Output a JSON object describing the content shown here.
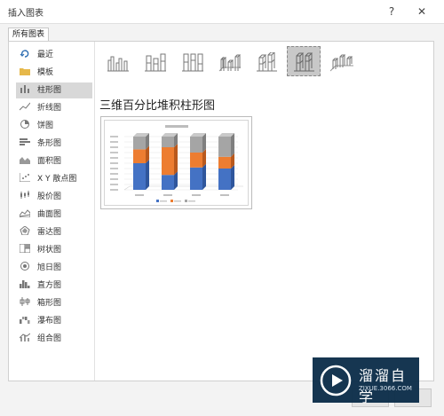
{
  "window": {
    "title": "插入图表",
    "help_label": "?",
    "close_label": "✕"
  },
  "tab": {
    "label": "所有图表"
  },
  "sidebar": {
    "items": [
      {
        "label": "最近",
        "icon": "recent-icon"
      },
      {
        "label": "模板",
        "icon": "folder-icon"
      },
      {
        "label": "柱形图",
        "icon": "column-chart-icon",
        "selected": true
      },
      {
        "label": "折线图",
        "icon": "line-chart-icon"
      },
      {
        "label": "饼图",
        "icon": "pie-chart-icon"
      },
      {
        "label": "条形图",
        "icon": "bar-chart-icon"
      },
      {
        "label": "面积图",
        "icon": "area-chart-icon"
      },
      {
        "label": "X Y 散点图",
        "icon": "scatter-chart-icon"
      },
      {
        "label": "股价图",
        "icon": "stock-chart-icon"
      },
      {
        "label": "曲面图",
        "icon": "surface-chart-icon"
      },
      {
        "label": "雷达图",
        "icon": "radar-chart-icon"
      },
      {
        "label": "树状图",
        "icon": "treemap-icon"
      },
      {
        "label": "旭日图",
        "icon": "sunburst-icon"
      },
      {
        "label": "直方图",
        "icon": "histogram-icon"
      },
      {
        "label": "箱形图",
        "icon": "box-whisker-icon"
      },
      {
        "label": "瀑布图",
        "icon": "waterfall-icon"
      },
      {
        "label": "组合图",
        "icon": "combo-chart-icon"
      }
    ]
  },
  "subtypes": {
    "selected_index": 5,
    "items": [
      "clustered-column-icon",
      "stacked-column-icon",
      "100-stacked-column-icon",
      "3d-clustered-column-icon",
      "3d-stacked-column-icon",
      "3d-100-stacked-column-icon",
      "3d-column-icon"
    ]
  },
  "main": {
    "heading": "三维百分比堆积柱形图"
  },
  "watermark": {
    "name": "溜溜自学",
    "url": "ZIXUE.3066.COM"
  },
  "colors": {
    "series1": "#4472c4",
    "series2": "#ed7d31",
    "series3": "#a5a5a5",
    "selection": "#c8c8c8"
  }
}
